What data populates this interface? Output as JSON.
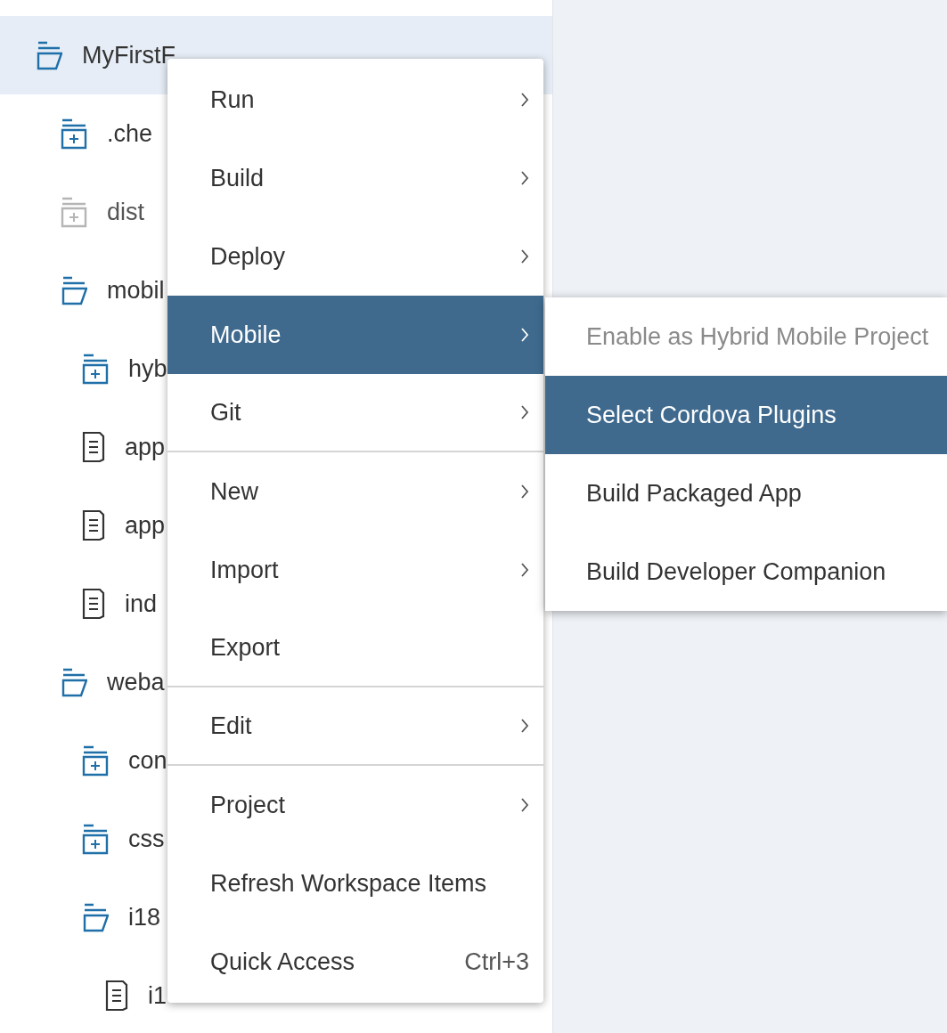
{
  "tree": [
    {
      "label": "MyFirstF",
      "kind": "folder-open",
      "selected": true,
      "disabled": false,
      "children": [
        {
          "label": ".che",
          "kind": "folder",
          "selected": false,
          "disabled": false
        },
        {
          "label": "dist",
          "kind": "folder",
          "selected": false,
          "disabled": true
        },
        {
          "label": "mobil",
          "kind": "folder-open",
          "selected": false,
          "disabled": false,
          "children": [
            {
              "label": "hyb",
              "kind": "folder",
              "selected": false,
              "disabled": false
            },
            {
              "label": "app",
              "kind": "file",
              "selected": false,
              "disabled": false
            },
            {
              "label": "app",
              "kind": "file",
              "selected": false,
              "disabled": false
            },
            {
              "label": "ind",
              "kind": "file",
              "selected": false,
              "disabled": false
            }
          ]
        },
        {
          "label": "weba",
          "kind": "folder-open",
          "selected": false,
          "disabled": false,
          "children": [
            {
              "label": "con",
              "kind": "folder",
              "selected": false,
              "disabled": false
            },
            {
              "label": "css",
              "kind": "folder",
              "selected": false,
              "disabled": false
            },
            {
              "label": "i18",
              "kind": "folder-open",
              "selected": false,
              "disabled": false,
              "children": [
                {
                  "label": "i1",
                  "kind": "file",
                  "selected": false,
                  "disabled": false
                }
              ]
            }
          ]
        }
      ]
    }
  ],
  "context_menu": [
    {
      "label": "Run",
      "submenu": true,
      "selected": false,
      "separator_after": false
    },
    {
      "label": "Build",
      "submenu": true,
      "selected": false,
      "separator_after": false
    },
    {
      "label": "Deploy",
      "submenu": true,
      "selected": false,
      "separator_after": false
    },
    {
      "label": "Mobile",
      "submenu": true,
      "selected": true,
      "separator_after": false
    },
    {
      "label": "Git",
      "submenu": true,
      "selected": false,
      "separator_after": true
    },
    {
      "label": "New",
      "submenu": true,
      "selected": false,
      "separator_after": false
    },
    {
      "label": "Import",
      "submenu": true,
      "selected": false,
      "separator_after": false
    },
    {
      "label": "Export",
      "submenu": false,
      "selected": false,
      "separator_after": true
    },
    {
      "label": "Edit",
      "submenu": true,
      "selected": false,
      "separator_after": true
    },
    {
      "label": "Project",
      "submenu": true,
      "selected": false,
      "separator_after": false
    },
    {
      "label": "Refresh Workspace Items",
      "submenu": false,
      "selected": false,
      "separator_after": false
    },
    {
      "label": "Quick Access",
      "submenu": false,
      "selected": false,
      "separator_after": false,
      "shortcut": "Ctrl+3"
    }
  ],
  "submenu": [
    {
      "label": "Enable as Hybrid Mobile Project",
      "selected": false,
      "disabled": true
    },
    {
      "label": "Select Cordova Plugins",
      "selected": true,
      "disabled": false
    },
    {
      "label": "Build Packaged App",
      "selected": false,
      "disabled": false
    },
    {
      "label": "Build Developer Companion",
      "selected": false,
      "disabled": false
    }
  ]
}
